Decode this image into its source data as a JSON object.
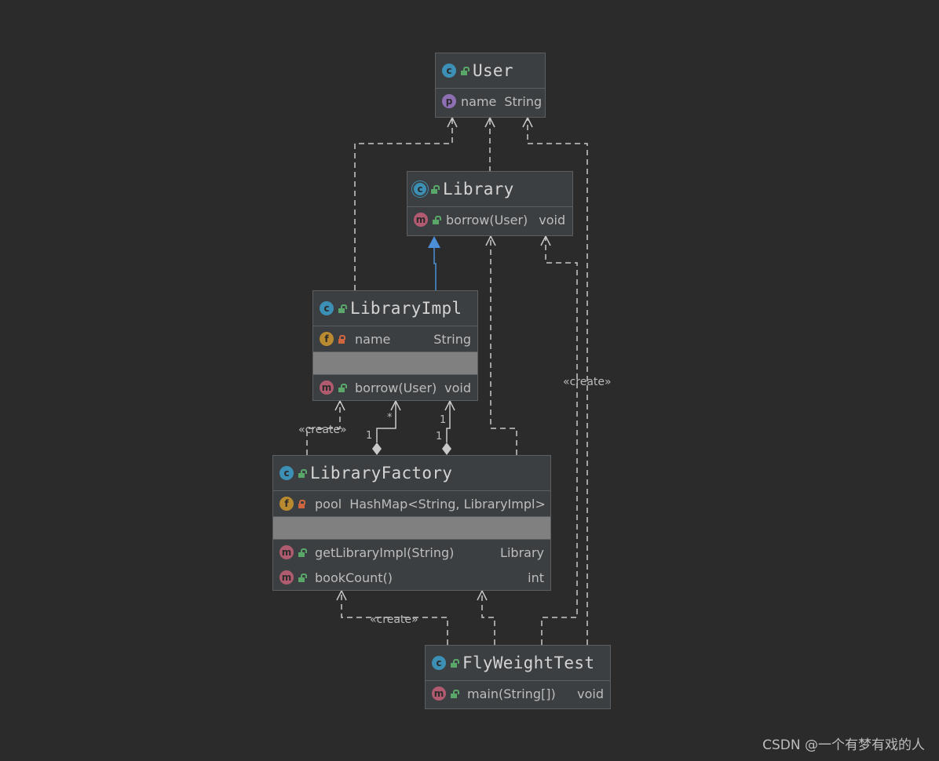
{
  "classes": {
    "user": {
      "name": "User",
      "fields": [
        {
          "name": "name",
          "type": "String"
        }
      ]
    },
    "library": {
      "name": "Library",
      "methods": [
        {
          "name": "borrow(User)",
          "type": "void"
        }
      ]
    },
    "library_impl": {
      "name": "LibraryImpl",
      "fields": [
        {
          "name": "name",
          "type": "String"
        }
      ],
      "methods": [
        {
          "name": "borrow(User)",
          "type": "void"
        }
      ]
    },
    "library_factory": {
      "name": "LibraryFactory",
      "fields": [
        {
          "name": "pool",
          "type": "HashMap<String, LibraryImpl>"
        }
      ],
      "methods": [
        {
          "name": "getLibraryImpl(String)",
          "type": "Library"
        },
        {
          "name": "bookCount()",
          "type": "int"
        }
      ]
    },
    "flyweight_test": {
      "name": "FlyWeightTest",
      "methods": [
        {
          "name": "main(String[])",
          "type": "void"
        }
      ]
    }
  },
  "badges": {
    "class": "c",
    "interface": "c",
    "property": "p",
    "field": "f",
    "method": "m"
  },
  "edge_labels": {
    "create": "«create»",
    "many": "*",
    "one": "1"
  },
  "watermark": "CSDN @一个有梦有戏的人",
  "colors": {
    "background": "#2b2b2b",
    "node_fill": "#3c3f41",
    "edge": "#c9c9c9",
    "inheritance": "#4a8fd8",
    "class_badge": "#3c8fb5",
    "method_badge": "#b05b70",
    "field_badge": "#b98a2f",
    "property_badge": "#8e6fb3"
  }
}
